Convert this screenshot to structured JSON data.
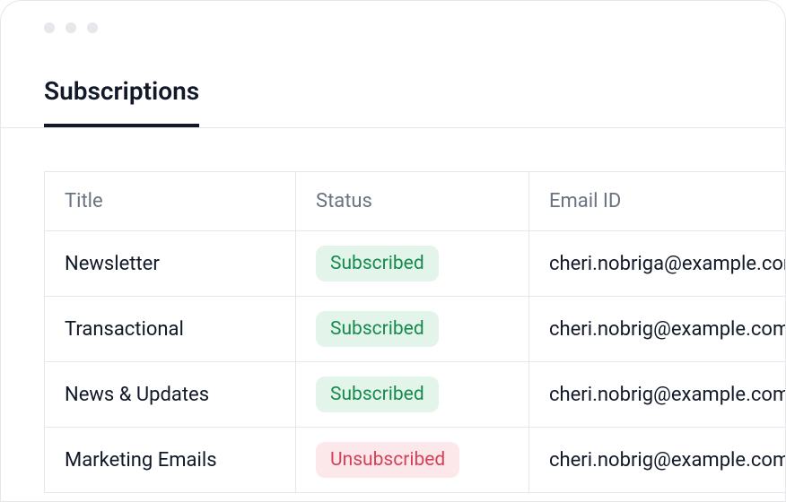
{
  "tabs": {
    "active": "Subscriptions"
  },
  "table": {
    "headers": {
      "title": "Title",
      "status": "Status",
      "email": "Email ID"
    },
    "rows": [
      {
        "title": "Newsletter",
        "status": "Subscribed",
        "status_type": "subscribed",
        "email": "cheri.nobriga@example.com"
      },
      {
        "title": "Transactional",
        "status": "Subscribed",
        "status_type": "subscribed",
        "email": "cheri.nobrig@example.com"
      },
      {
        "title": "News & Updates",
        "status": "Subscribed",
        "status_type": "subscribed",
        "email": "cheri.nobrig@example.com"
      },
      {
        "title": "Marketing Emails",
        "status": "Unsubscribed",
        "status_type": "unsubscribed",
        "email": "cheri.nobrig@example.com"
      }
    ]
  },
  "colors": {
    "subscribed_bg": "#e3f5ea",
    "subscribed_fg": "#178a4e",
    "unsubscribed_bg": "#fce8ea",
    "unsubscribed_fg": "#d4425a"
  }
}
